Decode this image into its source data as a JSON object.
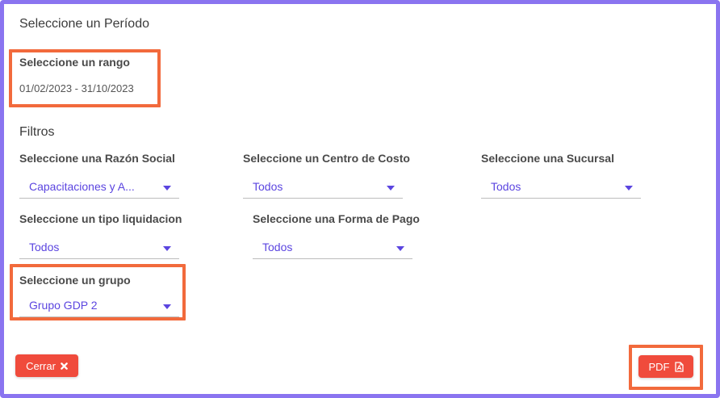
{
  "period": {
    "title": "Seleccione un Período",
    "range_label": "Seleccione un rango",
    "range_value": "01/02/2023 - 31/10/2023"
  },
  "filters": {
    "title": "Filtros",
    "razon_social": {
      "label": "Seleccione una Razón Social",
      "value": "Capacitaciones y A..."
    },
    "centro_costo": {
      "label": "Seleccione un Centro de Costo",
      "value": "Todos"
    },
    "sucursal": {
      "label": "Seleccione una Sucursal",
      "value": "Todos"
    },
    "tipo_liquidacion": {
      "label": "Seleccione un tipo liquidacion",
      "value": "Todos"
    },
    "forma_pago": {
      "label": "Seleccione una Forma de Pago",
      "value": "Todos"
    },
    "grupo": {
      "label": "Seleccione un grupo",
      "value": "Grupo GDP 2"
    }
  },
  "actions": {
    "close_label": "Cerrar",
    "close_icon": "close-icon",
    "pdf_label": "PDF",
    "pdf_icon": "pdf-file-icon"
  },
  "colors": {
    "frame": "#8a74f0",
    "highlight": "#f26a3c",
    "accent": "#5b45e0",
    "button": "#f04b3c"
  }
}
